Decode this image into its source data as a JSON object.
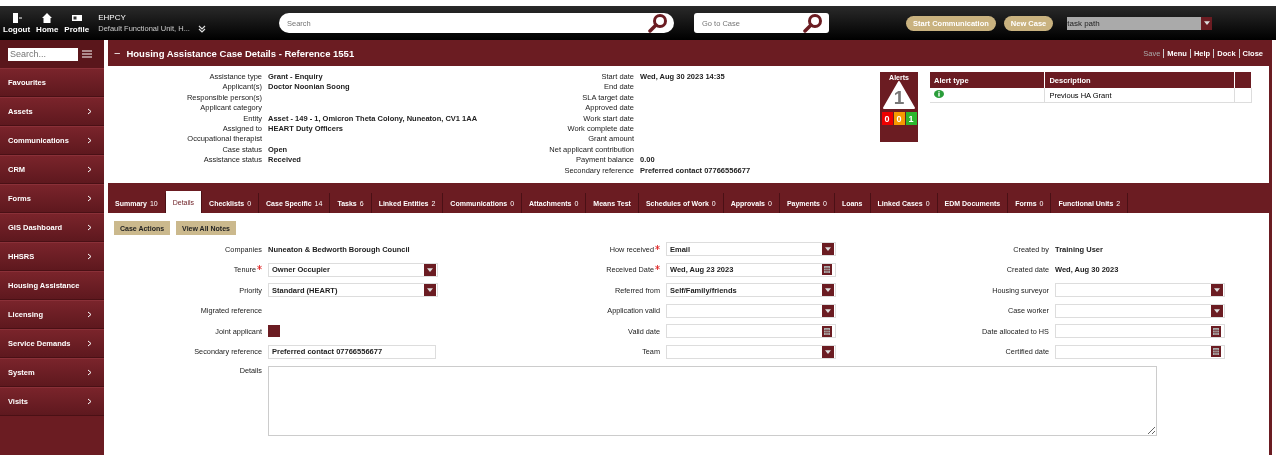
{
  "top_bar": {
    "nav": [
      {
        "label": "Logout",
        "kind": "logout"
      },
      {
        "label": "Home",
        "kind": "home"
      },
      {
        "label": "Profile",
        "kind": "profile"
      }
    ],
    "user": {
      "name": "EHPCY",
      "unit": "Default Functional Unit, H..."
    },
    "search": {
      "placeholder": "Search"
    },
    "go_to_case": {
      "placeholder": "Go to Case"
    },
    "buttons": [
      "Start Communication",
      "New Case"
    ],
    "task_select": {
      "value": "task path"
    }
  },
  "sidebar": {
    "search": {
      "placeholder": "Search..."
    },
    "items": [
      {
        "label": "Favourites",
        "arrow": false
      },
      {
        "label": "Assets",
        "arrow": true
      },
      {
        "label": "Communications",
        "arrow": true
      },
      {
        "label": "CRM",
        "arrow": true
      },
      {
        "label": "Forms",
        "arrow": true
      },
      {
        "label": "GIS Dashboard",
        "arrow": true
      },
      {
        "label": "HHSRS",
        "arrow": true
      },
      {
        "label": "Housing Assistance",
        "arrow": false
      },
      {
        "label": "Licensing",
        "arrow": true
      },
      {
        "label": "Service Demands",
        "arrow": true
      },
      {
        "label": "System",
        "arrow": true
      },
      {
        "label": "Visits",
        "arrow": true
      }
    ]
  },
  "panel": {
    "collapse": "−",
    "title": "Housing Assistance Case Details - Reference 1551",
    "actions": [
      {
        "label": "Save",
        "disabled": true
      },
      {
        "label": "Menu",
        "disabled": false
      },
      {
        "label": "Help",
        "disabled": false
      },
      {
        "label": "Dock",
        "disabled": false
      },
      {
        "label": "Close",
        "disabled": false
      }
    ]
  },
  "summary_left": [
    {
      "label": "Assistance type",
      "value": "Grant - Enquiry"
    },
    {
      "label": "Applicant(s)",
      "value": "Doctor Noonian Soong"
    },
    {
      "label": "Responsible person(s)"
    },
    {
      "label": "Applicant category"
    },
    {
      "label": "Entity",
      "value": "Asset - 149 - 1, Omicron Theta Colony, Nuneaton, CV1 1AA"
    },
    {
      "label": "Assigned to",
      "value": "HEART Duty Officers"
    },
    {
      "label": "Occupational therapist"
    },
    {
      "label": "Case status",
      "value": "Open"
    },
    {
      "label": "Assistance status",
      "value": "Received"
    }
  ],
  "summary_right": [
    {
      "label": "Start date",
      "value": "Wed, Aug 30 2023 14:35"
    },
    {
      "label": "End date"
    },
    {
      "label": "SLA target date"
    },
    {
      "label": "Approved date"
    },
    {
      "label": "Work start date"
    },
    {
      "label": "Work complete date"
    },
    {
      "label": "Grant amount"
    },
    {
      "label": "Net applicant contribution"
    },
    {
      "label": "Payment balance",
      "value": "0.00"
    },
    {
      "label": "Secondary reference",
      "value": "Preferred contact 07766556677"
    }
  ],
  "alerts": {
    "title": "Alerts",
    "total": "1",
    "counts": [
      {
        "value": "0",
        "color": "#ee0000"
      },
      {
        "value": "0",
        "color": "#f59a00"
      },
      {
        "value": "1",
        "color": "#2eb82e"
      }
    ],
    "columns": [
      "Alert type",
      "Description"
    ],
    "rows": [
      {
        "kind": "info",
        "description": "Previous HA Grant"
      }
    ]
  },
  "tabs": [
    {
      "label": "Summary",
      "count": "10",
      "selected": false
    },
    {
      "label": "Details",
      "selected": true
    },
    {
      "label": "Checklists",
      "count": "0",
      "selected": false
    },
    {
      "label": "Case Specific",
      "count": "14",
      "selected": false
    },
    {
      "label": "Tasks",
      "count": "6",
      "selected": false
    },
    {
      "label": "Linked Entities",
      "count": "2",
      "selected": false
    },
    {
      "label": "Communications",
      "count": "0",
      "selected": false
    },
    {
      "label": "Attachments",
      "count": "0",
      "selected": false
    },
    {
      "label": "Means Test",
      "selected": false
    },
    {
      "label": "Schedules of Work",
      "count": "0",
      "selected": false
    },
    {
      "label": "Approvals",
      "count": "0",
      "selected": false
    },
    {
      "label": "Payments",
      "count": "0",
      "selected": false
    },
    {
      "label": "Loans",
      "selected": false
    },
    {
      "label": "Linked Cases",
      "count": "0",
      "selected": false
    },
    {
      "label": "EDM Documents",
      "selected": false
    },
    {
      "label": "Forms",
      "count": "0",
      "selected": false
    },
    {
      "label": "Functional Units",
      "count": "2",
      "selected": false
    }
  ],
  "detail_buttons": [
    "Case Actions",
    "View All Notes"
  ],
  "field_columns": [
    [
      {
        "label": "Companies",
        "kind": "static",
        "required": false,
        "value": "Nuneaton & Bedworth Borough Council"
      },
      {
        "label": "Tenure",
        "kind": "select",
        "required": true,
        "value": "Owner Occupier"
      },
      {
        "label": "Priority",
        "kind": "select",
        "required": false,
        "value": "Standard (HEART)"
      },
      {
        "label": "Migrated reference",
        "kind": "static",
        "required": false
      },
      {
        "label": "Joint applicant",
        "kind": "checkbox",
        "required": false,
        "checked": true
      },
      {
        "label": "Secondary reference",
        "kind": "text",
        "required": false,
        "value": "Preferred contact 07766556677"
      }
    ],
    [
      {
        "label": "How received",
        "kind": "select",
        "required": true,
        "value": "Email"
      },
      {
        "label": "Received Date",
        "kind": "date",
        "required": true,
        "value": "Wed, Aug 23 2023"
      },
      {
        "label": "Referred from",
        "kind": "select",
        "required": false,
        "value": "Self/Family/friends"
      },
      {
        "label": "Application valid",
        "kind": "select",
        "required": false
      },
      {
        "label": "Valid date",
        "kind": "date",
        "required": false
      },
      {
        "label": "Team",
        "kind": "select",
        "required": false
      }
    ],
    [
      {
        "label": "Created by",
        "kind": "static",
        "required": false,
        "value": "Training User"
      },
      {
        "label": "Created date",
        "kind": "static",
        "required": false,
        "value": "Wed, Aug 30 2023"
      },
      {
        "label": "Housing surveyor",
        "kind": "select",
        "required": false
      },
      {
        "label": "Case worker",
        "kind": "select",
        "required": false
      },
      {
        "label": "Date allocated to HS",
        "kind": "date",
        "required": false
      },
      {
        "label": "Certified date",
        "kind": "date",
        "required": false
      }
    ]
  ],
  "details_field": {
    "label": "Details"
  }
}
